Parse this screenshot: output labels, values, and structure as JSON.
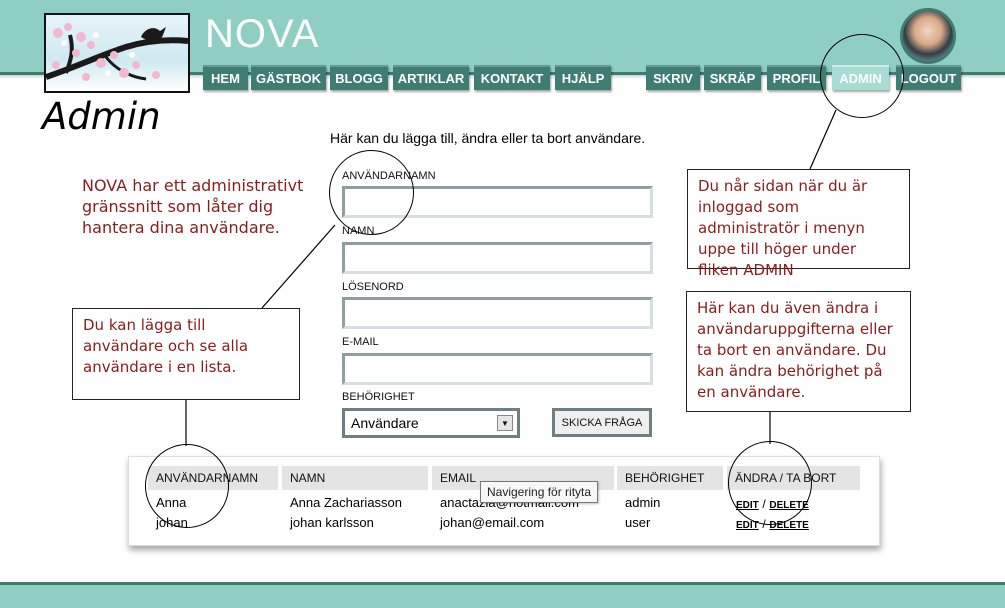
{
  "header": {
    "brand": "NOVA",
    "nav_left": [
      "HEM",
      "GÄSTBOK",
      "BLOGG",
      "ARTIKLAR",
      "KONTAKT",
      "HJÄLP"
    ],
    "nav_right": [
      "SKRIV",
      "SKRÄP",
      "PROFIL",
      "ADMIN",
      "LOGOUT"
    ],
    "active_tab": "ADMIN"
  },
  "page": {
    "title": "Admin",
    "intro": "Här kan du lägga till, ändra eller ta bort användare."
  },
  "form": {
    "username_label": "ANVÄNDARNAMN",
    "name_label": "NAMN",
    "password_label": "LÖSENORD",
    "email_label": "E-MAIL",
    "permission_label": "BEHÖRIGHET",
    "permission_selected": "Användare",
    "submit_label": "SKICKA FRÅGA"
  },
  "callouts": {
    "admin_intro": "NOVA har ett administrativt gränssnitt som låter dig hantera dina användare.",
    "add_users": "Du kan lägga till användare och se alla användare i en lista.",
    "access": "Du når sidan när du är inloggad som administratör i menyn uppe till höger under fliken ADMIN",
    "edit_users": "Här kan du även ändra i användaruppgifterna eller ta bort en användare. Du kan ändra behörighet på en användare."
  },
  "table": {
    "headers": [
      "ANVÄNDARNAMN",
      "NAMN",
      "EMAIL",
      "BEHÖRIGHET",
      "ÄNDRA / TA BORT"
    ],
    "rows": [
      {
        "username": "Anna",
        "name": "Anna Zachariasson",
        "email": "anactazia@hotmail.com",
        "permission": "admin",
        "edit": "EDIT",
        "delete": "DELETE"
      },
      {
        "username": "johan",
        "name": "johan karlsson",
        "email": "johan@email.com",
        "permission": "user",
        "edit": "EDIT",
        "delete": "DELETE"
      }
    ],
    "separator": "/"
  },
  "tooltip": "Navigering för rityta",
  "colors": {
    "header_teal": "#8fcfc3",
    "nav_dark": "#3f7d72",
    "nav_active": "#a6dcd2",
    "callout_red": "#8b1c1c"
  }
}
